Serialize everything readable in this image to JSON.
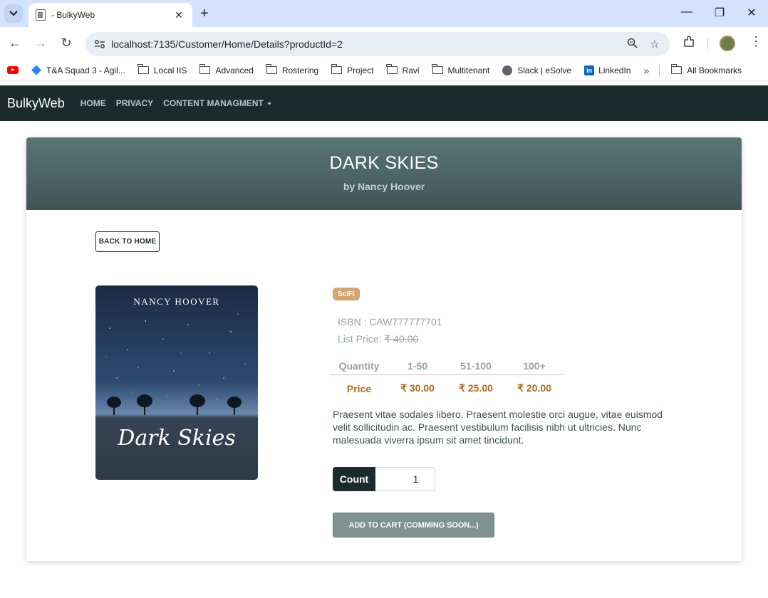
{
  "browser": {
    "tab_title": "- BulkyWeb",
    "tab_close": "✕",
    "new_tab": "+",
    "url": "localhost:7135/Customer/Home/Details?productId=2",
    "window_controls": {
      "minimize": "—",
      "restore": "❐",
      "close": "✕"
    },
    "bookmarks": [
      {
        "label": "T&A Squad 3 - Agil...",
        "icon": "jira-icon"
      },
      {
        "label": "Local IIS",
        "icon": "folder-icon"
      },
      {
        "label": "Advanced",
        "icon": "folder-icon"
      },
      {
        "label": "Rostering",
        "icon": "folder-icon"
      },
      {
        "label": "Project",
        "icon": "folder-icon"
      },
      {
        "label": "Ravi",
        "icon": "folder-icon"
      },
      {
        "label": "Multitenant",
        "icon": "folder-icon"
      },
      {
        "label": "Slack | eSolve",
        "icon": "globe-icon"
      },
      {
        "label": "LinkedIn",
        "icon": "linkedin-icon"
      }
    ],
    "bookmarks_more": "»",
    "all_bookmarks": "All Bookmarks"
  },
  "site_nav": {
    "brand": "BulkyWeb",
    "links": [
      "HOME",
      "PRIVACY",
      "CONTENT MANAGMENT"
    ]
  },
  "product": {
    "title": "DARK SKIES",
    "by_line": "by Nancy Hoover",
    "back_label": "BACK TO HOME",
    "cover_author": "NANCY HOOVER",
    "cover_title": "Dark Skies",
    "category": "SciFi",
    "isbn_text": "ISBN : CAW777777701",
    "list_price_label": "List Price: ",
    "list_price_value": "₹ 40.00",
    "price_table": {
      "headers": [
        "Quantity",
        "1-50",
        "51-100",
        "100+"
      ],
      "row": [
        "Price",
        "₹ 30.00",
        "₹ 25.00",
        "₹ 20.00"
      ]
    },
    "description": "Praesent vitae sodales libero. Praesent molestie orci augue, vitae euismod velit sollicitudin ac. Praesent vestibulum facilisis nibh ut ultricies. Nunc malesuada viverra ipsum sit amet tincidunt.",
    "count_label": "Count",
    "count_value": "1",
    "cart_label": "ADD TO CART (COMMING SOON...)"
  },
  "colors": {
    "navbar": "#1b2b2b",
    "header_top": "#5b7677",
    "header_bottom": "#3e5556",
    "badge": "#d2a673",
    "price": "#b26a1f",
    "cart_button": "#7f9190"
  }
}
